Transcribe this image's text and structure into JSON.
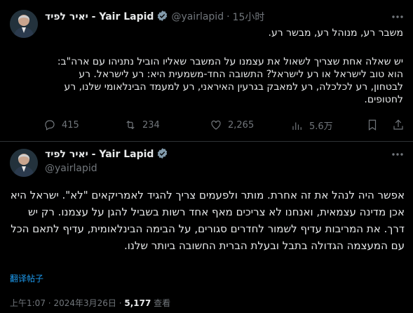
{
  "tweet1": {
    "display_name": "יאיר לפיד - Yair Lapid",
    "handle": "@yairlapid",
    "separator": "·",
    "time_ago": "15小时",
    "paragraph1": "משבר רע, מנוהל רע, מבשר רע.",
    "paragraph2": "יש שאלה אחת שצריך לשאול את עצמנו על המשבר שאליו הוביל נתניהו עם ארה\"ב: הוא טוב לישראל או רע לישראל? התשובה החד-משמעית היא: רע לישראל. רע לבטחון, רע לכלכלה, רע למאבק בגרעין האיראני, רע למעמד הבינלאומי שלנו, רע לחטופים.",
    "metrics": {
      "replies": "415",
      "retweets": "234",
      "likes": "2,265",
      "views": "5.6万"
    }
  },
  "tweet2": {
    "display_name": "יאיר לפיד - Yair Lapid",
    "handle": "@yairlapid",
    "body": "אפשר היה לנהל את זה אחרת. מותר ולפעמים צריך להגיד לאמריקאים \"לא\". ישראל היא אכן מדינה עצמאית, ואנחנו לא צריכים מאף אחד רשות בשביל להגן על עצמנו. רק יש דרך. את המריבות עדיף לשמור לחדרים סגורים, על הבימה הבינלאומית, עדיף לתאם הכל עם המעצמה הגדולה בתבל ובעלת הברית החשובה ביותר שלנו.",
    "translate_label": "翻译帖子",
    "time": "上午1:07",
    "dot": "·",
    "date": "2024年3月26日",
    "views_count": "5,177",
    "views_label": "查看"
  },
  "colors": {
    "background": "#000000",
    "text": "#e7e9ea",
    "muted": "#71767b",
    "link": "#1d9bf0",
    "divider": "#2f3336"
  },
  "icons": [
    "more-icon",
    "verified-badge-icon",
    "reply-icon",
    "retweet-icon",
    "like-icon",
    "views-icon",
    "bookmark-icon",
    "share-icon"
  ]
}
